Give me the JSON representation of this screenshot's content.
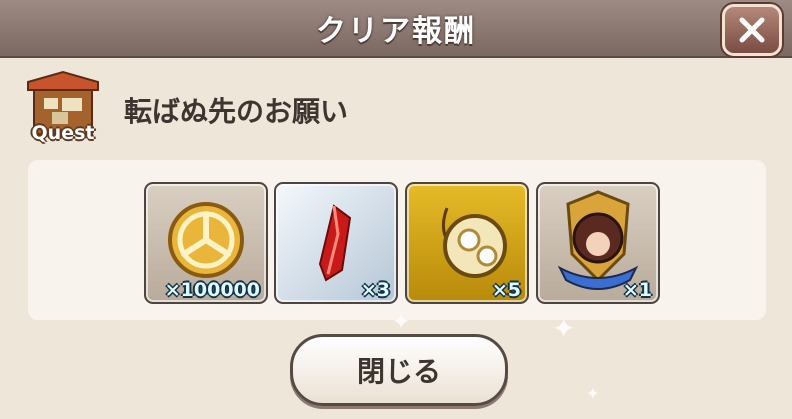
{
  "dialog": {
    "title": "クリア報酬",
    "close_icon": "close-x-icon"
  },
  "quest": {
    "icon": "quest-shop-icon",
    "icon_label": "Quest",
    "name": "転ばぬ先のお願い"
  },
  "rewards": [
    {
      "icon": "gold-coin-icon",
      "count": "×100000"
    },
    {
      "icon": "red-crystal-icon",
      "count": "×3"
    },
    {
      "icon": "golden-orb-pendant-icon",
      "count": "×5"
    },
    {
      "icon": "character-medal-icon",
      "count": "×1"
    }
  ],
  "footer": {
    "close_label": "閉じる"
  },
  "colors": {
    "title_bar": "#8a7870",
    "dialog_bg": "#efe6da",
    "count_text": "#dffaff"
  }
}
